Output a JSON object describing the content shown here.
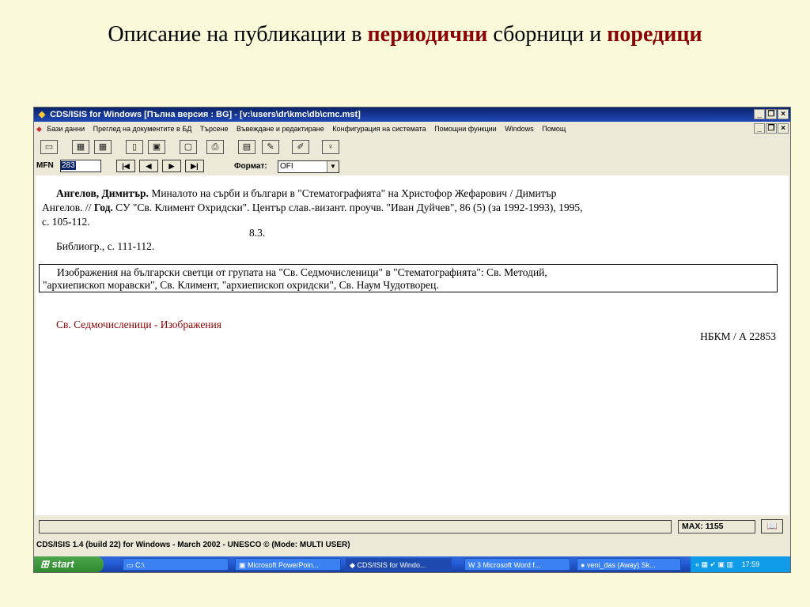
{
  "slide": {
    "title_part1": "Описание на публикации в ",
    "title_hl1": "периодични",
    "title_part2": " сборници и ",
    "title_hl2": "поредици"
  },
  "window": {
    "title": "CDS/ISIS for Windows [Пълна версия : BG] - [v:\\users\\dr\\kmc\\db\\cmc.mst]",
    "menu": [
      "Бази данни",
      "Преглед на документите в БД",
      "Търсене",
      "Въвеждане и редактиране",
      "Конфигурация на системата",
      "Помощни функции",
      "Windows",
      "Помощ"
    ],
    "mfn_label": "MFN",
    "mfn_value": "283",
    "format_label": "Формат:",
    "format_value": "OFI",
    "max_label": "MAX: 1155",
    "status_bar": "CDS/ISIS 1.4 (build 22) for Windows - March 2002 - UNESCO ©  (Mode: MULTI USER)"
  },
  "record": {
    "author": "Ангелов, Димитър.",
    "line1_rest": "  Миналото на сърби и българи в \"Стематографията\" на Христофор Жефарович / Димитър",
    "line2_a": "Ангелов. // ",
    "line2_god": "Год.",
    "line2_b": " СУ \"Св. Климент Охридски\". Център слав.-визант. проучв. \"Иван Дуйчев\", 86 (5) (за 1992-1993), 1995,",
    "line3": "с. 105-112.",
    "udc": "8.3.",
    "biblio": "Библиогр., с. 111-112.",
    "note_line1": "Изображения на български светци от групата на \"Св. Седмочисленици\" в \"Стематографията\": Св. Методий,",
    "note_line2": "\"архиепископ моравски\", Св. Климент, \"архиепископ охридски\", Св. Наум Чудотворец.",
    "subject": "Св. Седмочисленици - Изображения",
    "location": "НБКМ / А 22853"
  },
  "taskbar": {
    "start": "start",
    "tasks": [
      "C:\\",
      "Microsoft PowerPoin...",
      "CDS/ISIS for Windo...",
      "3 Microsoft Word f...",
      "veni_das (Away) Sk..."
    ],
    "clock": "17:59"
  },
  "colors": {
    "highlight": "#8b0000",
    "background": "#fbfbdc"
  }
}
